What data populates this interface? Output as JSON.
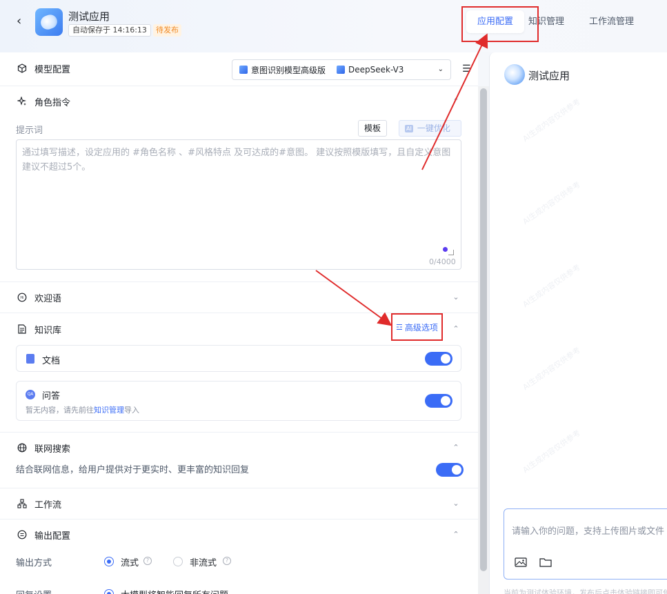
{
  "header": {
    "back_icon": "chevron-left-icon",
    "app_title": "测试应用",
    "autosave": "自动保存于 14:16:13",
    "status": "待发布",
    "tabs": [
      {
        "label": "应用配置",
        "active": true
      },
      {
        "label": "知识管理",
        "active": false
      },
      {
        "label": "工作流管理",
        "active": false
      }
    ]
  },
  "model": {
    "title": "模型配置",
    "intent_model": "意图识别模型高级版",
    "llm": "DeepSeek-V3"
  },
  "role": {
    "title": "角色指令",
    "prompt_label": "提示词",
    "template_btn": "模板",
    "ai_badge": "AI",
    "optimize_btn": "一键优化",
    "placeholder": "通过填写描述，设定应用的 #角色名称 、#风格特点 及可达成的#意图。 建议按照模版填写，且自定义意图建议不超过5个。",
    "counter": "0/4000"
  },
  "welcome": {
    "title": "欢迎语"
  },
  "knowledge": {
    "title": "知识库",
    "advanced": "高级选项",
    "doc_label": "文档",
    "qa_badge": "QA",
    "qa_label": "问答",
    "qa_hint_prefix": "暂无内容，请先前往",
    "qa_hint_link": "知识管理",
    "qa_hint_suffix": "导入",
    "doc_enabled": true,
    "qa_enabled": true
  },
  "web": {
    "title": "联网搜索",
    "desc": "结合联网信息，给用户提供对于更实时、更丰富的知识回复",
    "enabled": true
  },
  "workflow": {
    "title": "工作流"
  },
  "output": {
    "title": "输出配置",
    "mode_label": "输出方式",
    "mode_stream": "流式",
    "mode_nonstream": "非流式",
    "reply_label": "回复设置",
    "reply_option": "大模型将智能回复所有问题"
  },
  "preview": {
    "title": "测试应用",
    "input_placeholder": "请输入你的问题，支持上传图片或文件",
    "footer": "当前为测试体验环境，发布后点击体验链接即可使用",
    "watermark": "AI生成内容仅供参考"
  },
  "colors": {
    "accent": "#3b6cf6",
    "annotation": "#e02b2b",
    "pending": "#f08a24"
  }
}
